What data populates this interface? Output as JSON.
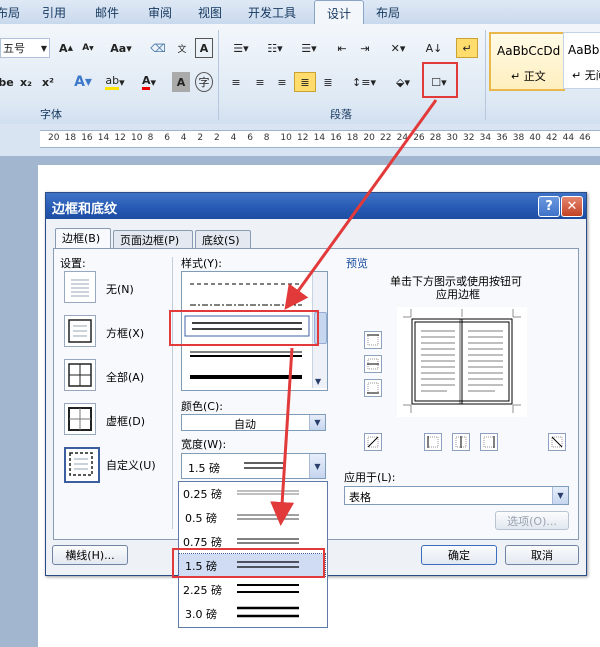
{
  "ribbon": {
    "tabs": [
      "布局",
      "引用",
      "邮件",
      "审阅",
      "视图",
      "开发工具",
      "设计",
      "布局"
    ],
    "active_tab_index": 6,
    "font_size": "五号",
    "group_font": "字体",
    "group_paragraph": "段落",
    "style_sample": "AaBbCcDd",
    "style_sample_2": "AaBbC",
    "style_normal": "↵ 正文",
    "style_nospacing": "↵ 无间"
  },
  "ruler": {
    "numbers": [
      "20",
      "18",
      "16",
      "14",
      "12",
      "10",
      "8",
      "6",
      "4",
      "2",
      "2",
      "4",
      "6",
      "8",
      "10",
      "12",
      "14",
      "16",
      "18",
      "20",
      "22",
      "24",
      "26",
      "28",
      "30",
      "32",
      "34",
      "36",
      "38",
      "40",
      "42",
      "44",
      "46"
    ]
  },
  "dialog": {
    "title": "边框和底纹",
    "help": "?",
    "close": "✕",
    "tabs": [
      "边框(B)",
      "页面边框(P)",
      "底纹(S)"
    ],
    "settings_label": "设置:",
    "settings": [
      "无(N)",
      "方框(X)",
      "全部(A)",
      "虚框(D)",
      "自定义(U)"
    ],
    "style_label": "样式(Y):",
    "color_label": "颜色(C):",
    "color_value": "自动",
    "width_label": "宽度(W):",
    "width_value": "1.5 磅",
    "preview_label": "预览",
    "preview_hint_1": "单击下方图示或使用按钮可",
    "preview_hint_2": "应用边框",
    "apply_label": "应用于(L):",
    "apply_value": "表格",
    "options_button": "选项(O)...",
    "hline_button": "横线(H)...",
    "ok_button": "确定",
    "cancel_button": "取消"
  },
  "width_options": [
    "0.25 磅",
    "0.5 磅",
    "0.75 磅",
    "1.5 磅",
    "2.25 磅",
    "3.0 磅"
  ],
  "selected_width_index": 3
}
